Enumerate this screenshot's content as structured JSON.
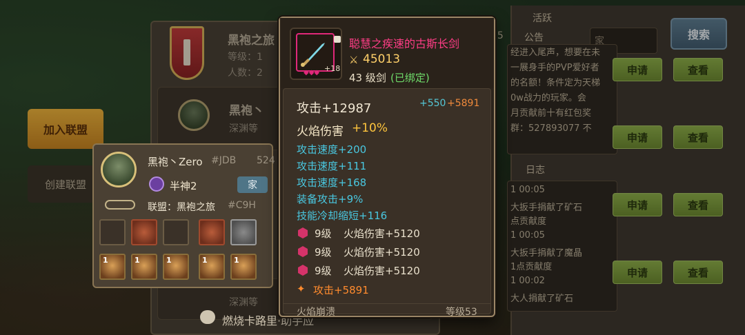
{
  "guild_list": {
    "guild_name": "黑袍之旅",
    "level_label": "等级：1",
    "members_label": "人数：2",
    "member_name": "黑袍丶",
    "member_sub": "深渊等",
    "member_sub2": "深渊等",
    "join_button": "加入联盟",
    "create_button": "创建联盟"
  },
  "right_panel": {
    "tab_label": "公告",
    "activity_label": "活跃",
    "search_placeholder": "家",
    "search_button": "搜索",
    "right_count": "55",
    "notice_lines": [
      "经进入尾声，想要在未",
      "一展身手的PVP爱好者",
      "的名额！条件定为天梯",
      "0w战力的玩家。会",
      "月贡献前十有红包奖",
      "群：527893077 不"
    ],
    "log_title": "日志",
    "log_entries": [
      {
        "time": "1 00:05",
        "text": "大扳手捐献了矿石",
        "text2": "点贡献度"
      },
      {
        "time": "1 00:05",
        "text": "大扳手捐献了魔晶",
        "text2": "1点贡献度"
      },
      {
        "time": "1 00:02",
        "text": "大人捐献了矿石",
        "text2": ""
      }
    ],
    "apply_label": "申请",
    "view_label": "查看"
  },
  "player_card": {
    "name": "黑袍丶Zero",
    "tag": "#JDB",
    "rank": "半神2",
    "guild": "联盟：黑袍之旅",
    "guild_tag": "#C9H",
    "family_button": "家",
    "hero_levels": [
      "1",
      "1",
      "1",
      "1",
      "1"
    ],
    "number_right": "524"
  },
  "chat": {
    "text": "燃烧卡路里·助手应"
  },
  "tooltip": {
    "item_name": "聪慧之疾速的古斯长剑",
    "power": "45013",
    "level_text": "43 级剑",
    "bound_text": "(已绑定)",
    "enhance": "+18",
    "main_stat": "攻击+12987",
    "main_bonus_cyan": "+550",
    "main_bonus_orange": "+5891",
    "fire_label": "火焰伤害",
    "fire_value": "+10%",
    "cyan_stats": [
      "攻击速度+200",
      "攻击速度+111",
      "攻击速度+168",
      "装备攻击+9%",
      "技能冷却缩短+116"
    ],
    "gems": [
      {
        "level": "9级",
        "effect": "火焰伤害+5120"
      },
      {
        "level": "9级",
        "effect": "火焰伤害+5120"
      },
      {
        "level": "9级",
        "effect": "火焰伤害+5120"
      }
    ],
    "attack_bonus": "攻击+5891",
    "skill_name": "火焰崩溃",
    "skill_level": "等级53"
  },
  "colors": {
    "item_name": "#ff3d86",
    "gold": "#ffd06a",
    "cyan": "#49c7e0",
    "bound": "#6fdc6a",
    "bonus_orange": "#ff8b2e"
  }
}
